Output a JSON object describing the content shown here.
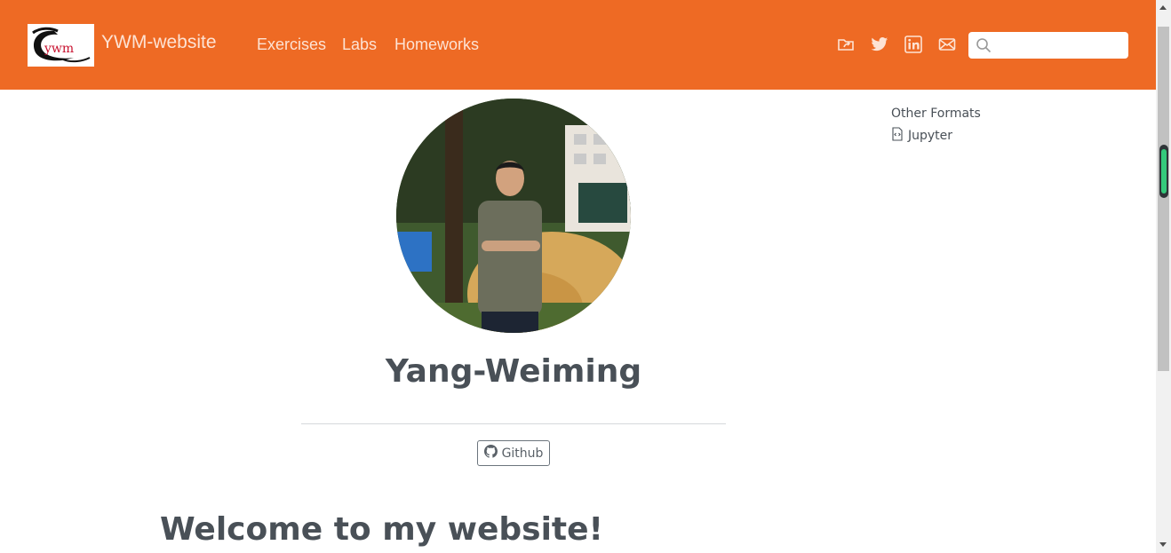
{
  "navbar": {
    "brand": "YWM-website",
    "logo_text": "ywm",
    "links": [
      "Exercises",
      "Labs",
      "Homeworks"
    ],
    "icons": [
      "folder-share-icon",
      "twitter-icon",
      "linkedin-icon",
      "envelope-icon"
    ],
    "search_placeholder": "",
    "background": "#ee6a24"
  },
  "sidebar": {
    "other_formats_label": "Other Formats",
    "jupyter_label": "Jupyter"
  },
  "profile": {
    "name": "Yang-Weiming",
    "github_label": "Github"
  },
  "content": {
    "heading": "Welcome to my website!"
  }
}
